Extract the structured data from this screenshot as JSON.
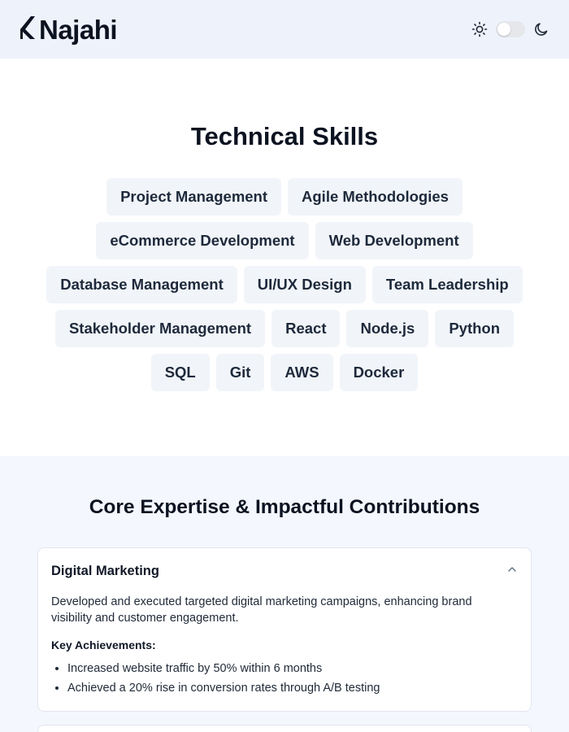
{
  "header": {
    "logo_text": "Najahi",
    "icons": {
      "light": "sun-icon",
      "dark": "moon-icon",
      "logo": "najahi-logo-mark"
    },
    "theme_toggle_on": false
  },
  "skills": {
    "title": "Technical Skills",
    "items": [
      "Project Management",
      "Agile Methodologies",
      "eCommerce Development",
      "Web Development",
      "Database Management",
      "UI/UX Design",
      "Team Leadership",
      "Stakeholder Management",
      "React",
      "Node.js",
      "Python",
      "SQL",
      "Git",
      "AWS",
      "Docker"
    ]
  },
  "expertise": {
    "title": "Core Expertise & Impactful Contributions",
    "cards": [
      {
        "title": "Digital Marketing",
        "expanded": true,
        "description": "Developed and executed targeted digital marketing campaigns, enhancing brand visibility and customer engagement.",
        "achievements_label": "Key Achievements:",
        "achievements": [
          "Increased website traffic by 50% within 6 months",
          "Achieved a 20% rise in conversion rates through A/B testing"
        ]
      }
    ]
  },
  "colors": {
    "header_bg": "#eef2fb",
    "chip_bg": "#f1f5f9",
    "section_bg": "#f4f7fd",
    "text_dark": "#0b1220"
  }
}
